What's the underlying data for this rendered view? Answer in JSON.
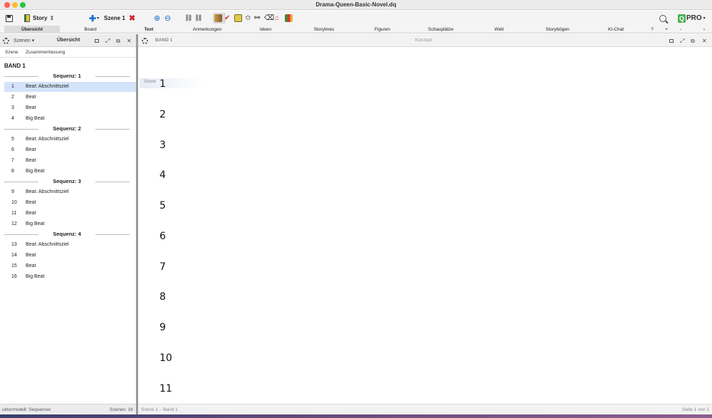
{
  "window": {
    "title": "Drama-Queen-Basic-Novel.dq"
  },
  "toolbar": {
    "project_label": "Story",
    "scene_label": "Szene 1"
  },
  "tabs": [
    {
      "label": "Übersicht"
    },
    {
      "label": "Board"
    },
    {
      "label": "Text"
    },
    {
      "label": "Anmerkungen"
    },
    {
      "label": "Ideen"
    },
    {
      "label": "Storylines"
    },
    {
      "label": "Figuren"
    },
    {
      "label": "Schauplätze"
    },
    {
      "label": "Welt"
    },
    {
      "label": "Storybögen"
    },
    {
      "label": "KI-Chat"
    },
    {
      "label": "?"
    },
    {
      "label": "+"
    },
    {
      "label": "-"
    }
  ],
  "left_panel": {
    "dropdown_label": "Szenen",
    "title": "Übersicht",
    "col_scene": "Szene",
    "col_summary": "Zusammenfassung",
    "band_title": "BAND 1",
    "sequences": [
      {
        "label": "Sequenz: 1",
        "scenes": [
          {
            "num": "1",
            "summary": "Beat: Abschnittsziel"
          },
          {
            "num": "2",
            "summary": "Beat"
          },
          {
            "num": "3",
            "summary": "Beat"
          },
          {
            "num": "4",
            "summary": "Big Beat"
          }
        ]
      },
      {
        "label": "Sequenz: 2",
        "scenes": [
          {
            "num": "5",
            "summary": "Beat: Abschnittsziel"
          },
          {
            "num": "6",
            "summary": "Beat"
          },
          {
            "num": "7",
            "summary": "Beat"
          },
          {
            "num": "8",
            "summary": "Big Beat"
          }
        ]
      },
      {
        "label": "Sequenz: 3",
        "scenes": [
          {
            "num": "9",
            "summary": "Beat: Abschnittsziel"
          },
          {
            "num": "10",
            "summary": "Beat"
          },
          {
            "num": "11",
            "summary": "Beat"
          },
          {
            "num": "12",
            "summary": "Big Beat"
          }
        ]
      },
      {
        "label": "Sequenz: 4",
        "scenes": [
          {
            "num": "13",
            "summary": "Beat: Abschnittsziel"
          },
          {
            "num": "14",
            "summary": "Beat"
          },
          {
            "num": "15",
            "summary": "Beat"
          },
          {
            "num": "16",
            "summary": "Big Beat"
          }
        ]
      }
    ],
    "footer_left": "ukturmodell: Sequencer",
    "footer_right": "Szenen: 16"
  },
  "right_panel": {
    "band_label": "BAND 1",
    "mode_label": "Konzept",
    "scene_tag": "Szene",
    "numbers": [
      "1",
      "2",
      "3",
      "4",
      "5",
      "6",
      "7",
      "8",
      "9",
      "10",
      "11"
    ],
    "footer_left": "Szene 1 – Band 1",
    "footer_right": "Seite 1 von 1"
  }
}
